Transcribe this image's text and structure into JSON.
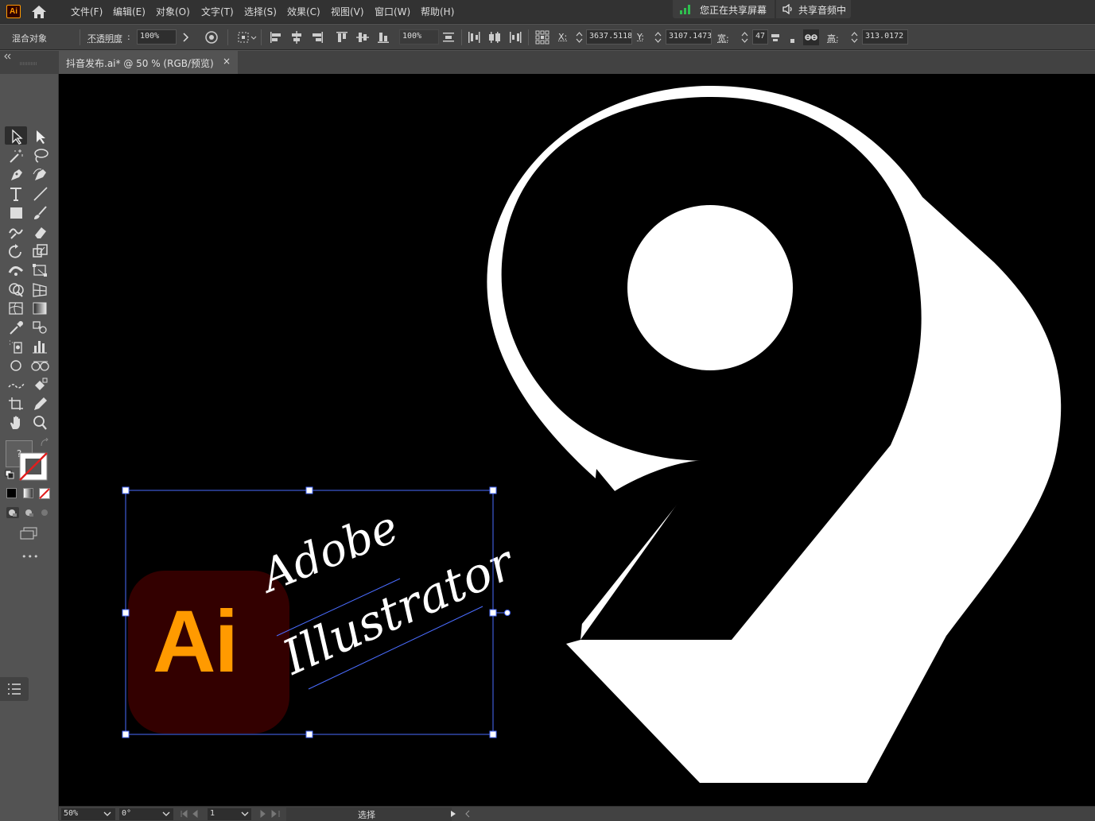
{
  "app": {
    "logo": "Ai",
    "home_icon": "home-icon"
  },
  "menu": [
    "文件(F)",
    "编辑(E)",
    "对象(O)",
    "文字(T)",
    "选择(S)",
    "效果(C)",
    "视图(V)",
    "窗口(W)",
    "帮助(H)"
  ],
  "sharing": {
    "screen": "您正在共享屏幕",
    "audio": "共享音频中"
  },
  "controlbar": {
    "object_type": "混合对象",
    "opacity_label": "不透明度",
    "opacity_value": "100%",
    "align_value": "100%",
    "x_label": "X:",
    "x_value": "3637.5118",
    "y_label": "Y:",
    "y_value": "3107.1473",
    "w_label": "宽:",
    "w_value": "47",
    "h_label": "高:",
    "h_value": "313.0172"
  },
  "document": {
    "tab_title": "抖音发布.ai* @ 50 % (RGB/预览)",
    "close": "×"
  },
  "artwork": {
    "logo_text": "Ai",
    "script_line1": "Adobe",
    "script_line2": "Illustrator",
    "colors": {
      "logo_bg": "#330000",
      "logo_text": "#ff9a00",
      "script": "#ffffff",
      "selection": "#4a6cff",
      "number_fill": "#ffffff"
    }
  },
  "statusbar": {
    "zoom": "50%",
    "rotation": "0°",
    "artboard": "1",
    "status": "选择"
  },
  "toolbar": {
    "more": "•••",
    "fill_unknown": "?"
  }
}
